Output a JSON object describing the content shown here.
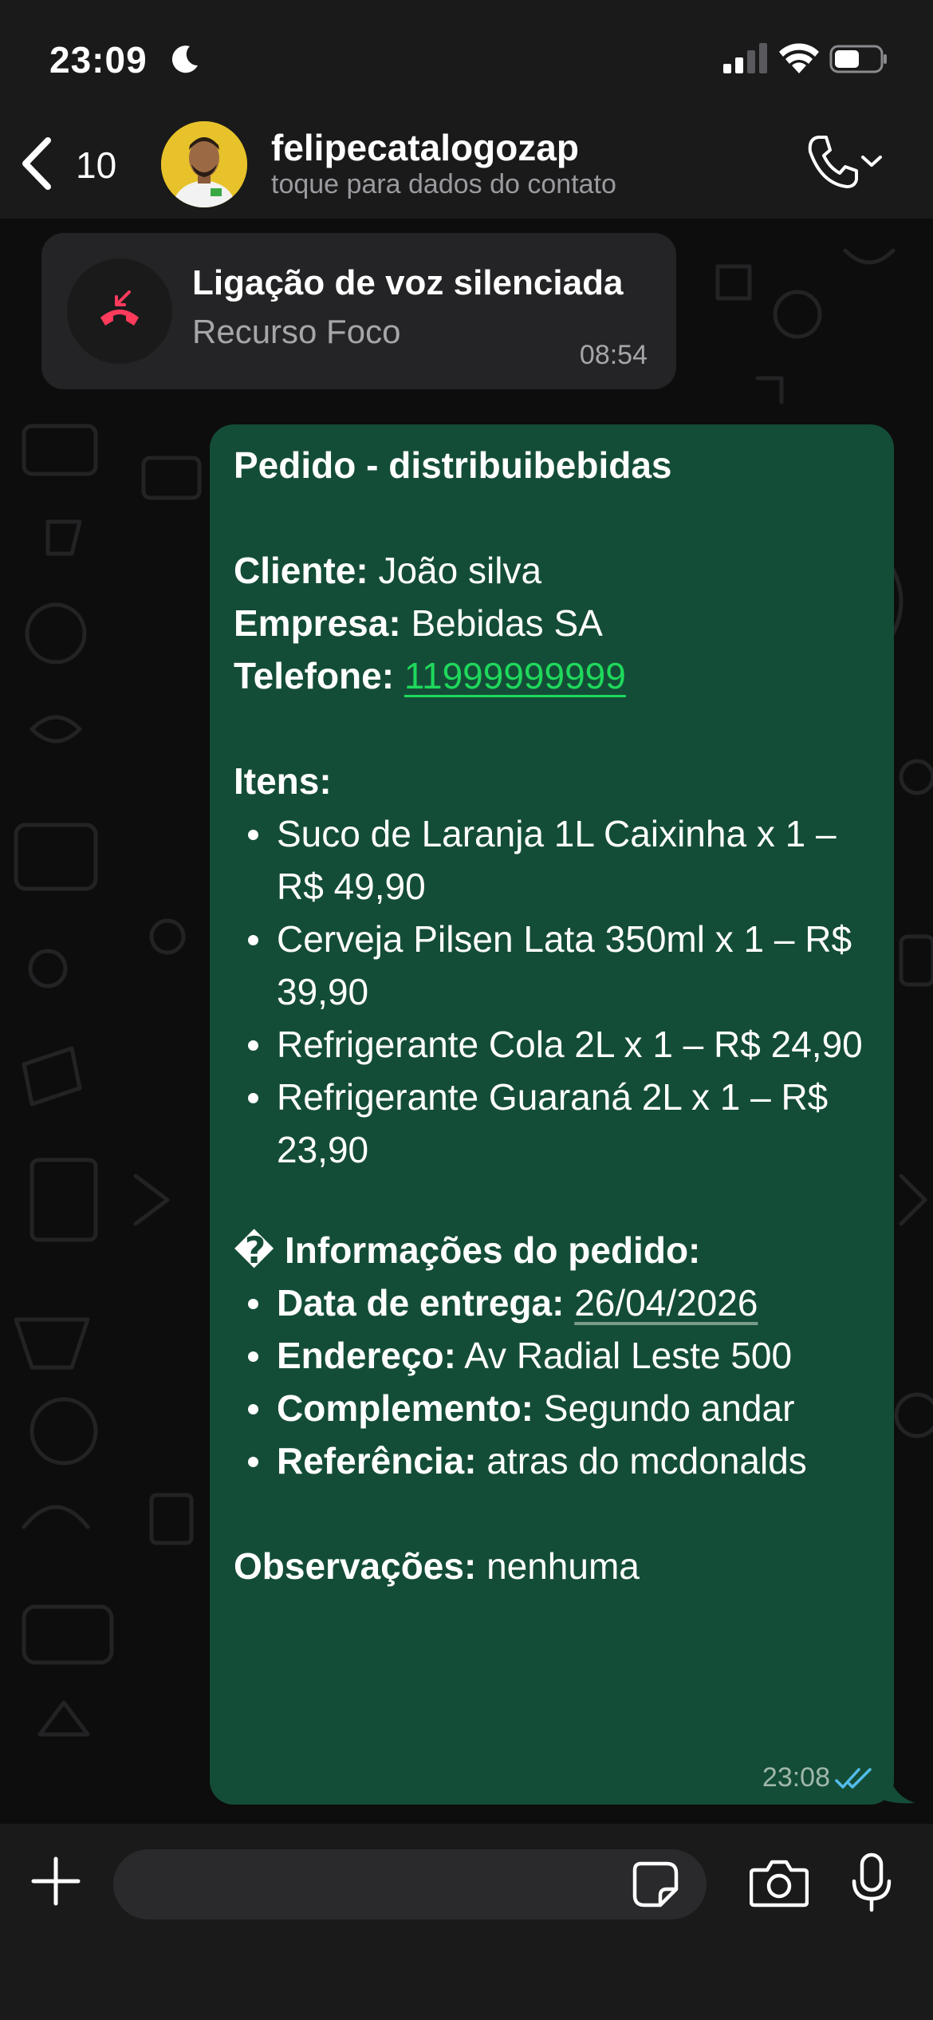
{
  "status_bar": {
    "time": "23:09"
  },
  "header": {
    "back_count": "10",
    "contact_name": "felipecatalogozap",
    "contact_subtitle": "toque para dados do contato"
  },
  "call_notice": {
    "title": "Ligação de voz silenciada",
    "subtitle": "Recurso Foco",
    "time": "08:54"
  },
  "order_message": {
    "title": "Pedido - distribuibebidas",
    "client_label": "Cliente:",
    "client_value": "João silva",
    "company_label": "Empresa:",
    "company_value": "Bebidas SA",
    "phone_label": "Telefone:",
    "phone_value": "11999999999",
    "items_label": "Itens:",
    "items": [
      "Suco de Laranja 1L Caixinha x 1 – R$ 49,90",
      "Cerveja Pilsen Lata 350ml x 1 – R$ 39,90",
      "Refrigerante Cola 2L x 1 – R$ 24,90",
      "Refrigerante Guaraná 2L x 1 – R$ 23,90"
    ],
    "info_heading": "� Informações do pedido:",
    "delivery_label": "Data de entrega:",
    "delivery_value": "26/04/2026",
    "address_label": "Endereço:",
    "address_value": "Av Radial Leste 500",
    "complement_label": "Complemento:",
    "complement_value": "Segundo andar",
    "reference_label": "Referência:",
    "reference_value": "atras do mcdonalds",
    "notes_label": "Observações:",
    "notes_value": "nenhuma",
    "time": "23:08",
    "read_status": "read"
  },
  "composer": {
    "placeholder": ""
  },
  "colors": {
    "bubble_outgoing": "#144d37",
    "bubble_incoming": "#242426",
    "link": "#1fd85c",
    "read_ticks": "#53bdeb",
    "missed_call": "#ff3b5c"
  }
}
